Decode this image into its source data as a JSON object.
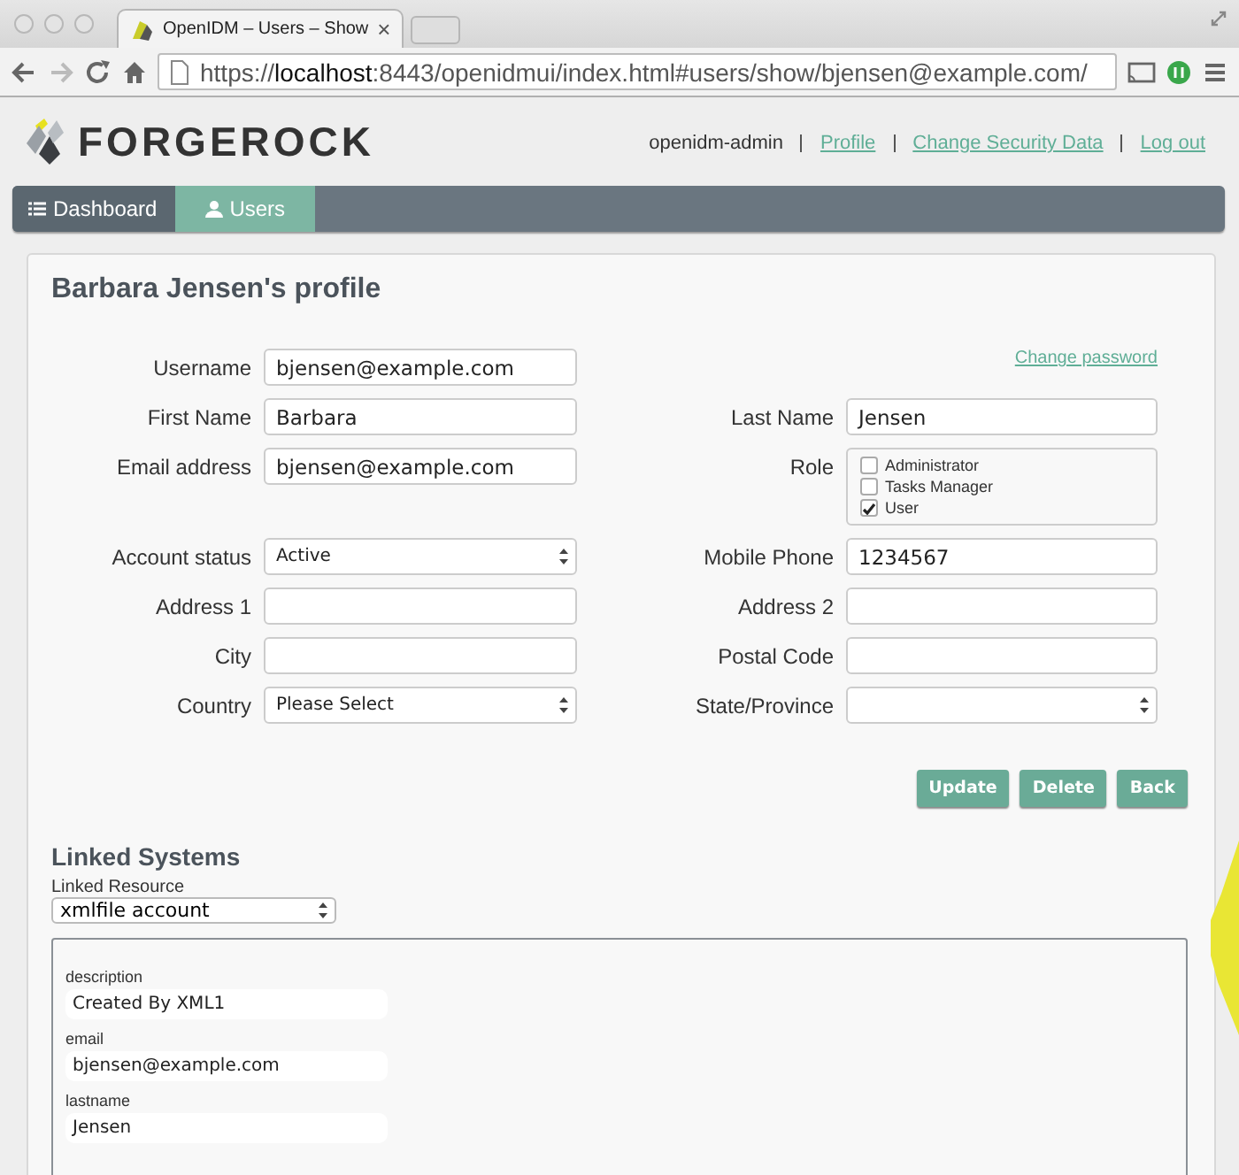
{
  "browser": {
    "tab_title": "OpenIDM – Users – Show",
    "tab_close": "×",
    "url": "https://**localhost**:8443/openidmui/index.html#users/show/bjensen@example.com/"
  },
  "header": {
    "logo_text": "FORGEROCK",
    "user": "openidm-admin",
    "links": [
      "Profile",
      "Change Security Data",
      "Log out"
    ]
  },
  "nav": [
    {
      "label": "Dashboard",
      "selected": false
    },
    {
      "label": "Users",
      "selected": true
    }
  ],
  "profile": {
    "title": "Barbara Jensen's profile",
    "rows": [
      {
        "left": {
          "kind": "text",
          "label": "Username",
          "value": "bjensen@example.com"
        },
        "right": {
          "kind": "link",
          "value": "Change password"
        }
      },
      {
        "left": {
          "kind": "text",
          "label": "First Name",
          "value": "Barbara"
        },
        "right": {
          "kind": "text",
          "label": "Last Name",
          "value": "Jensen"
        }
      },
      {
        "left": {
          "kind": "text",
          "label": "Email address",
          "value": "bjensen@example.com"
        },
        "right": {
          "kind": "checklist",
          "label": "Role",
          "options": [
            {
              "label": "Administrator",
              "checked": false
            },
            {
              "label": "Tasks Manager",
              "checked": false
            },
            {
              "label": "User",
              "checked": true
            }
          ]
        }
      },
      {
        "left": {
          "kind": "select",
          "label": "Account status",
          "value": "Active"
        },
        "right": {
          "kind": "text",
          "label": "Mobile Phone",
          "value": "1234567"
        }
      },
      {
        "left": {
          "kind": "text",
          "label": "Address 1"
        },
        "right": {
          "kind": "text",
          "label": "Address 2"
        }
      },
      {
        "left": {
          "kind": "text",
          "label": "City"
        },
        "right": {
          "kind": "text",
          "label": "Postal Code"
        }
      },
      {
        "left": {
          "kind": "select",
          "label": "Country",
          "value": "Please Select"
        },
        "right": {
          "kind": "select",
          "label": "State/Province"
        }
      }
    ],
    "buttons": [
      "Update",
      "Delete",
      "Back"
    ]
  },
  "linked": {
    "title": "Linked Systems",
    "resource_label": "Linked Resource",
    "resource_value": "xmlfile account",
    "attributes": [
      {
        "name": "description",
        "value": "Created By XML1"
      },
      {
        "name": "email",
        "value": "bjensen@example.com"
      },
      {
        "name": "lastname",
        "value": "Jensen"
      }
    ]
  }
}
